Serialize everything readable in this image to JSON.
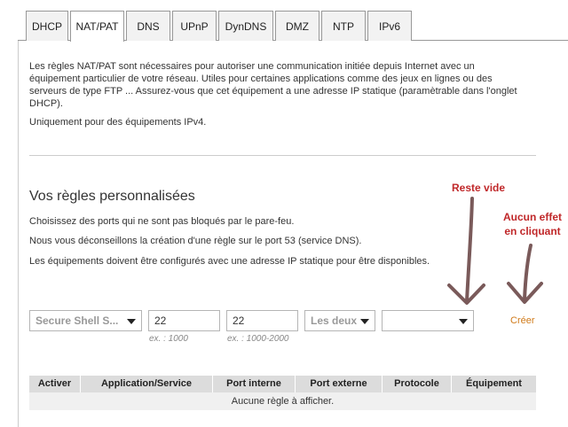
{
  "tabs": [
    "DHCP",
    "NAT/PAT",
    "DNS",
    "UPnP",
    "DynDNS",
    "DMZ",
    "NTP",
    "IPv6"
  ],
  "active_tab": "NAT/PAT",
  "intro": {
    "text": "Les règles NAT/PAT sont nécessaires pour autoriser une communication initiée depuis Internet avec un équipement particulier de votre réseau. Utiles pour certaines applications comme des jeux en lignes ou des serveurs de type FTP ... Assurez-vous que cet équipement a une adresse IP statique (paramètrable dans l'onglet DHCP).",
    "ipv4_note": "Uniquement pour des équipements IPv4."
  },
  "rules": {
    "title": "Vos règles personnalisées",
    "hints": [
      "Choisissez des ports qui ne sont pas bloqués par le pare-feu.",
      "Nous vous déconseillons la création d'une règle sur le port 53 (service DNS).",
      "Les équipements doivent être configurés avec une adresse IP statique pour être disponibles."
    ],
    "form": {
      "service_select": "Secure Shell S...",
      "internal_port": "22",
      "internal_port_example": "ex. : 1000",
      "external_port": "22",
      "external_port_example": "ex. : 1000-2000",
      "protocol_select": "Les deux",
      "device_select": "",
      "create_label": "Créer"
    },
    "table": {
      "headers": [
        "Activer",
        "Application/Service",
        "Port interne",
        "Port externe",
        "Protocole",
        "Équipement"
      ],
      "empty_message": "Aucune règle à afficher."
    }
  },
  "annotations": {
    "empty_note": "Reste vide",
    "no_effect_line1": "Aucun effet",
    "no_effect_line2": "en cliquant"
  },
  "colors": {
    "accent_link": "#d07a19",
    "annotation": "#c0282a",
    "annotation_arrow": "#7a5a5a",
    "table_header_bg": "#dcdcdc",
    "table_row_bg": "#f0f0f0"
  }
}
